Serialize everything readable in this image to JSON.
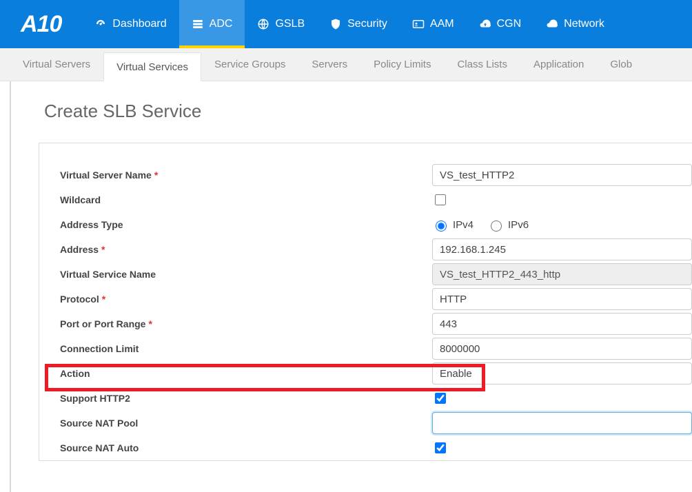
{
  "brand": "A10",
  "nav": [
    {
      "id": "dashboard",
      "label": "Dashboard",
      "icon": "gauge"
    },
    {
      "id": "adc",
      "label": "ADC",
      "icon": "stack",
      "active": true
    },
    {
      "id": "gslb",
      "label": "GSLB",
      "icon": "globe"
    },
    {
      "id": "security",
      "label": "Security",
      "icon": "shield"
    },
    {
      "id": "aam",
      "label": "AAM",
      "icon": "idcard"
    },
    {
      "id": "cgn",
      "label": "CGN",
      "icon": "cloudout"
    },
    {
      "id": "network",
      "label": "Network",
      "icon": "cloud"
    }
  ],
  "subtabs": [
    {
      "id": "virtual-servers",
      "label": "Virtual Servers"
    },
    {
      "id": "virtual-services",
      "label": "Virtual Services",
      "active": true
    },
    {
      "id": "service-groups",
      "label": "Service Groups"
    },
    {
      "id": "servers",
      "label": "Servers"
    },
    {
      "id": "policy-limits",
      "label": "Policy Limits"
    },
    {
      "id": "class-lists",
      "label": "Class Lists"
    },
    {
      "id": "application",
      "label": "Application"
    },
    {
      "id": "global",
      "label": "Glob"
    }
  ],
  "page": {
    "title": "Create SLB Service"
  },
  "form": {
    "virtual_server_name": {
      "label": "Virtual Server Name",
      "required": true,
      "value": "VS_test_HTTP2"
    },
    "wildcard": {
      "label": "Wildcard",
      "checked": false
    },
    "address_type": {
      "label": "Address Type",
      "ipv4_label": "IPv4",
      "ipv6_label": "IPv6",
      "value": "ipv4"
    },
    "address": {
      "label": "Address",
      "required": true,
      "value": "192.168.1.245"
    },
    "virtual_service_name": {
      "label": "Virtual Service Name",
      "value": "VS_test_HTTP2_443_http"
    },
    "protocol": {
      "label": "Protocol",
      "required": true,
      "value": "HTTP"
    },
    "port": {
      "label": "Port or Port Range",
      "required": true,
      "value": "443"
    },
    "connection_limit": {
      "label": "Connection Limit",
      "value": "8000000"
    },
    "action": {
      "label": "Action",
      "value": "Enable"
    },
    "support_http2": {
      "label": "Support HTTP2",
      "checked": true
    },
    "source_nat_pool": {
      "label": "Source NAT Pool",
      "value": ""
    },
    "source_nat_auto": {
      "label": "Source NAT Auto",
      "checked": true
    }
  }
}
